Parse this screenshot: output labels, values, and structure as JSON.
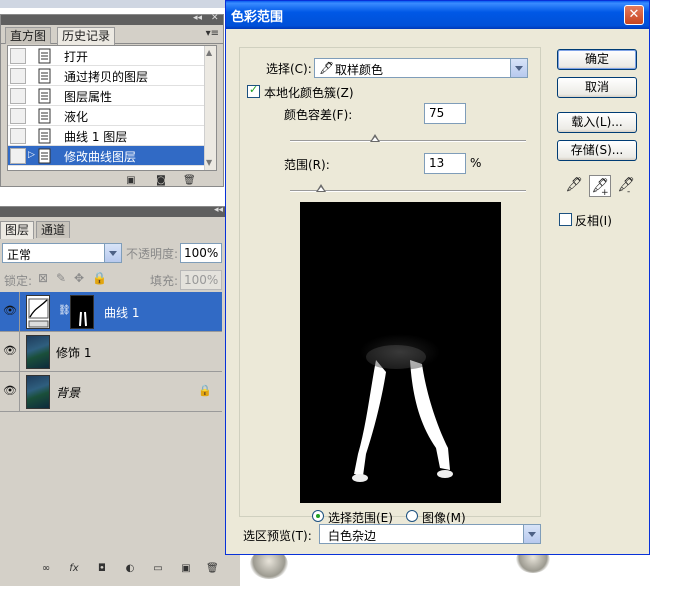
{
  "history_panel": {
    "tabs": [
      "直方图",
      "历史记录"
    ],
    "active_tab": "历史记录",
    "items": [
      "打开",
      "通过拷贝的图层",
      "图层属性",
      "液化",
      "曲线 1 图层",
      "修改曲线图层"
    ],
    "selected_item": "修改曲线图层"
  },
  "layers_panel": {
    "tabs": [
      "图层",
      "通道"
    ],
    "active_tab": "图层",
    "blend_mode": "正常",
    "opacity_label": "不透明度:",
    "opacity_value": "100%",
    "lock_label": "锁定:",
    "fill_label": "填充:",
    "fill_value": "100%",
    "layers": [
      {
        "name": "曲线 1",
        "type": "adjustment",
        "selected": true
      },
      {
        "name": "修饰 1",
        "type": "photo",
        "selected": false
      },
      {
        "name": "背景",
        "type": "photo",
        "locked": true,
        "selected": false
      }
    ]
  },
  "dialog": {
    "title": "色彩范围",
    "select_label": "选择(C):",
    "select_value": "取样颜色",
    "localized_label": "本地化颜色簇(Z)",
    "localized_checked": true,
    "fuzziness_label": "颜色容差(F):",
    "fuzziness_value": "75",
    "fuzziness_level": 0.36,
    "range_label": "范围(R):",
    "range_value": "13",
    "range_unit": "%",
    "range_level": 0.13,
    "radio_selection": "选择范围(E)",
    "radio_image": "图像(M)",
    "radio_selected": "selection",
    "preview_label": "选区预览(T):",
    "preview_value": "白色杂边",
    "buttons": {
      "ok": "确定",
      "cancel": "取消",
      "load": "载入(L)...",
      "save": "存储(S)..."
    },
    "invert_label": "反相(I)",
    "invert_checked": false
  }
}
